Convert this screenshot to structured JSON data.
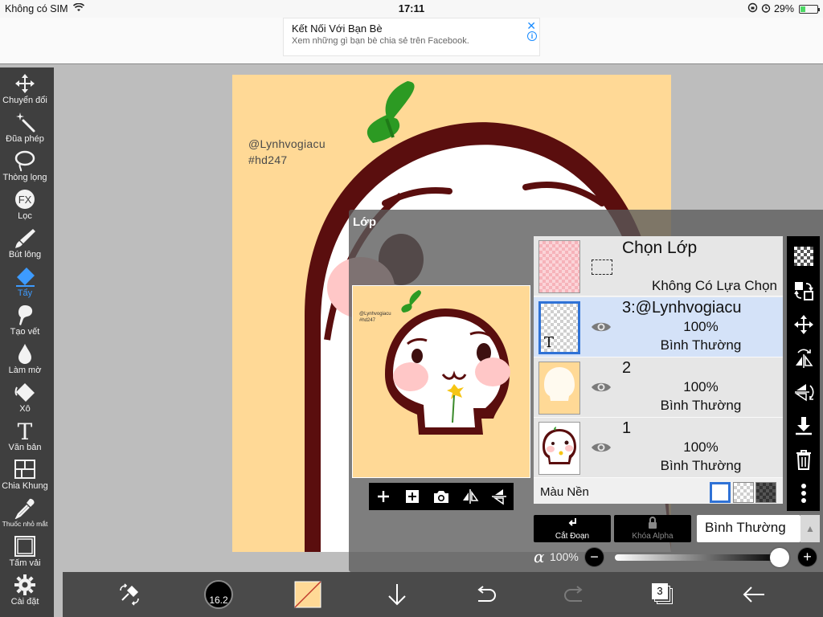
{
  "status": {
    "carrier": "Không có SIM",
    "time": "17:11",
    "battery": "29%",
    "battery_level": 0.29,
    "icons": [
      "wifi-icon",
      "orientation-lock-icon",
      "alarm-icon",
      "battery-icon"
    ]
  },
  "ad": {
    "title": "Kết Nối Với Bạn Bè",
    "subtitle": "Xem những gì bạn bè chia sẻ trên Facebook.",
    "close": "✕",
    "info": "i"
  },
  "toolbar": {
    "active_color": "#3d9bff",
    "tools": [
      {
        "icon": "move-icon",
        "label": "Chuyển đổi"
      },
      {
        "icon": "magic-wand-icon",
        "label": "Đũa phép"
      },
      {
        "icon": "lasso-icon",
        "label": "Thòng lọng"
      },
      {
        "icon": "fx-icon",
        "label": "Lọc",
        "glyph": "FX"
      },
      {
        "icon": "brush-icon",
        "label": "Bút lông"
      },
      {
        "icon": "eraser-icon",
        "label": "Tẩy",
        "active": true
      },
      {
        "icon": "smudge-icon",
        "label": "Tạo vết"
      },
      {
        "icon": "blur-drop-icon",
        "label": "Làm mờ"
      },
      {
        "icon": "bucket-icon",
        "label": "Xô"
      },
      {
        "icon": "text-icon",
        "label": "Văn bản",
        "glyph": "T"
      },
      {
        "icon": "frame-divider-icon",
        "label": "Chia Khung"
      },
      {
        "icon": "eyedropper-icon",
        "label": "Thuốc nhỏ mắt"
      },
      {
        "icon": "canvas-icon",
        "label": "Tấm vải"
      },
      {
        "icon": "gear-icon",
        "label": "Cài đặt"
      }
    ]
  },
  "artwork": {
    "watermark_line1": "@Lynhvogiacu",
    "watermark_line2": "#hd247",
    "background_color": "#ffd996"
  },
  "layer_panel": {
    "title": "Lớp",
    "selection_row": {
      "title": "Chọn Lớp",
      "subtitle": "Không Có Lựa Chọn"
    },
    "layers": [
      {
        "name": "3:@Lynhvogiacu",
        "opacity": "100%",
        "blend": "Bình Thường",
        "selected": true,
        "thumb_glyph": "T"
      },
      {
        "name": "2",
        "opacity": "100%",
        "blend": "Bình Thường",
        "selected": false
      },
      {
        "name": "1",
        "opacity": "100%",
        "blend": "Bình Thường",
        "selected": false
      }
    ],
    "background": {
      "label": "Màu Nền",
      "swatches": [
        "white-swatch",
        "checker-swatch",
        "dark-checker-swatch"
      ]
    },
    "clip_label": "Cắt Đoạn",
    "alpha_lock_label": "Khóa Alpha",
    "blend_mode": "Bình Thường",
    "alpha_symbol": "α",
    "opacity": "100%",
    "opacity_level": 1.0,
    "minus": "−",
    "plus": "+",
    "preview_tools": [
      "add-layer-icon",
      "duplicate-layer-icon",
      "camera-icon",
      "flip-horizontal-icon",
      "flip-vertical-icon"
    ],
    "side_tools": [
      "transparency-icon",
      "transform-select-icon",
      "move-layer-icon",
      "flip-h-layer-icon",
      "flip-v-layer-icon",
      "merge-down-icon",
      "trash-icon",
      "more-icon"
    ]
  },
  "bottombar": {
    "brush_size": "16.2",
    "layer_count": "3",
    "icons": [
      "transform-icon",
      "brush-size-icon",
      "color-icon",
      "download-icon",
      "undo-icon",
      "redo-icon",
      "layers-icon",
      "back-icon"
    ]
  }
}
